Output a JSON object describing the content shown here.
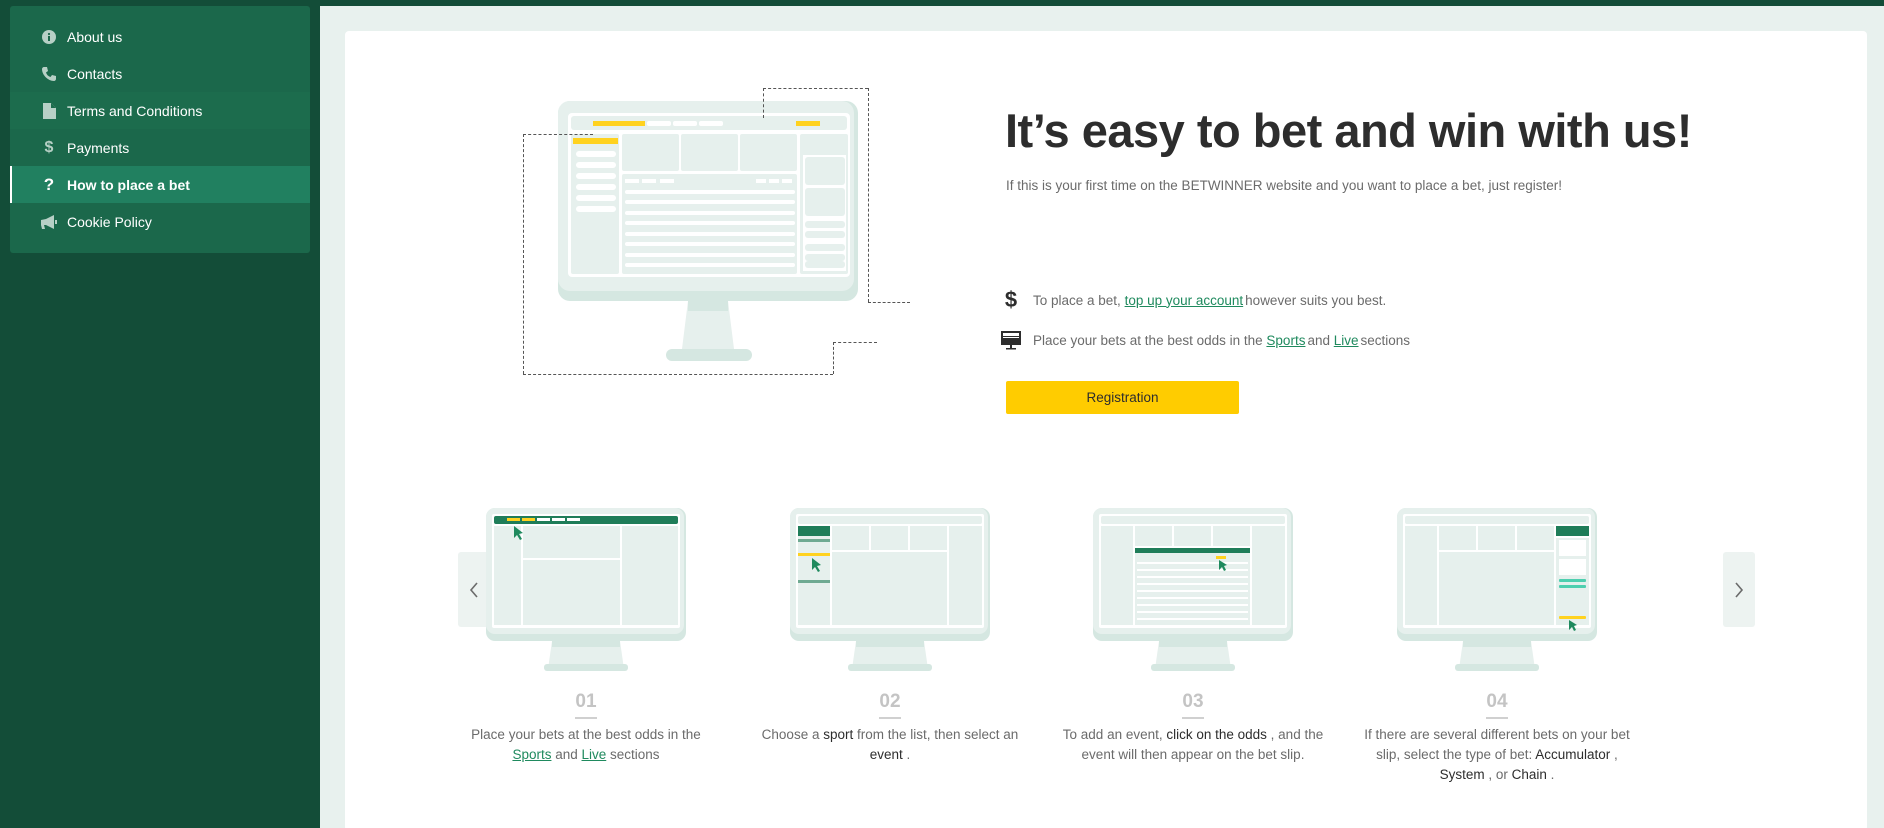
{
  "sidebar": {
    "items": [
      {
        "label": "About us",
        "icon": "info-icon",
        "active": false
      },
      {
        "label": "Contacts",
        "icon": "phone-icon",
        "active": false
      },
      {
        "label": "Terms and Conditions",
        "icon": "document-icon",
        "active": false
      },
      {
        "label": "Payments",
        "icon": "dollar-icon",
        "active": false
      },
      {
        "label": "How to place a bet",
        "icon": "question-icon",
        "active": true
      },
      {
        "label": "Cookie Policy",
        "icon": "megaphone-icon",
        "active": false
      }
    ]
  },
  "hero": {
    "title": "It’s easy to bet and win with us!",
    "subtitle": "If this is your first time on the BETWINNER website and you want to place a bet, just register!",
    "features": [
      {
        "icon": "dollar-icon",
        "prefix": "To place a bet, ",
        "link": "top up your account",
        "suffix": " however suits you best."
      },
      {
        "icon": "monitor-icon",
        "prefix": "Place your bets at the best odds in the ",
        "link1": "Sports",
        "middle": " and ",
        "link2": "Live",
        "suffix": " sections"
      }
    ],
    "register_label": "Registration"
  },
  "steps": [
    {
      "number": "01",
      "t1": "Place your bets at the best odds in the ",
      "link1": "Sports",
      "t2": " and ",
      "link2": "Live",
      "t3": " sections"
    },
    {
      "number": "02",
      "t1": "Choose a ",
      "b1": "sport",
      "t2": " from the list, then select an ",
      "b2": "event",
      "t3": " ."
    },
    {
      "number": "03",
      "t1": "To add an event, ",
      "b1": "click on the odds",
      "t2": " , and the event will then appear on the bet slip."
    },
    {
      "number": "04",
      "t1": "If there are several different bets on your bet slip, select the type of bet: ",
      "b1": "Accumulator",
      "t2": " , ",
      "b2": "System",
      "t3": " , or ",
      "b3": "Chain",
      "t4": " ."
    }
  ],
  "carousel": {
    "prev_icon": "chevron-left-icon",
    "next_icon": "chevron-right-icon"
  },
  "colors": {
    "brand_dark": "#134d38",
    "brand": "#1b684b",
    "active": "#218060",
    "accent": "#ffcc00",
    "link": "#1f8a5e"
  }
}
